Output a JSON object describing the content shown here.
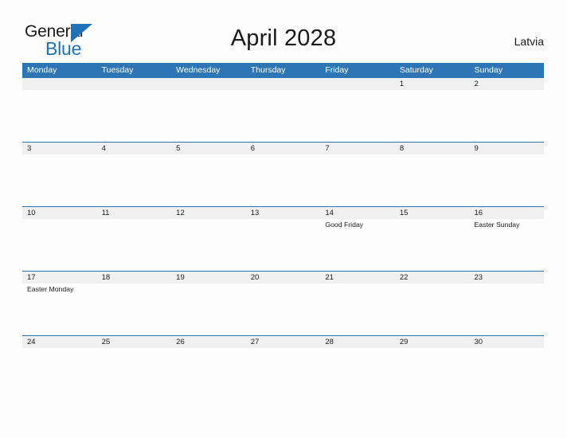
{
  "branding": {
    "name_part1": "General",
    "name_part2": "Blue",
    "triangle_icon": "triangle-icon",
    "colors": {
      "brand_blue": "#1f72b8",
      "header_blue": "#2e75b6",
      "date_band_gray": "#f0f0f0",
      "text_dark": "#1a1a1a",
      "page_background": "#fdfdfd"
    }
  },
  "header": {
    "title": "April 2028",
    "country": "Latvia"
  },
  "calendar": {
    "weekday_headers": [
      "Monday",
      "Tuesday",
      "Wednesday",
      "Thursday",
      "Friday",
      "Saturday",
      "Sunday"
    ],
    "weeks": [
      [
        {
          "day": "",
          "event": ""
        },
        {
          "day": "",
          "event": ""
        },
        {
          "day": "",
          "event": ""
        },
        {
          "day": "",
          "event": ""
        },
        {
          "day": "",
          "event": ""
        },
        {
          "day": "1",
          "event": ""
        },
        {
          "day": "2",
          "event": ""
        }
      ],
      [
        {
          "day": "3",
          "event": ""
        },
        {
          "day": "4",
          "event": ""
        },
        {
          "day": "5",
          "event": ""
        },
        {
          "day": "6",
          "event": ""
        },
        {
          "day": "7",
          "event": ""
        },
        {
          "day": "8",
          "event": ""
        },
        {
          "day": "9",
          "event": ""
        }
      ],
      [
        {
          "day": "10",
          "event": ""
        },
        {
          "day": "11",
          "event": ""
        },
        {
          "day": "12",
          "event": ""
        },
        {
          "day": "13",
          "event": ""
        },
        {
          "day": "14",
          "event": "Good Friday"
        },
        {
          "day": "15",
          "event": ""
        },
        {
          "day": "16",
          "event": "Easter Sunday"
        }
      ],
      [
        {
          "day": "17",
          "event": "Easter Monday"
        },
        {
          "day": "18",
          "event": ""
        },
        {
          "day": "19",
          "event": ""
        },
        {
          "day": "20",
          "event": ""
        },
        {
          "day": "21",
          "event": ""
        },
        {
          "day": "22",
          "event": ""
        },
        {
          "day": "23",
          "event": ""
        }
      ],
      [
        {
          "day": "24",
          "event": ""
        },
        {
          "day": "25",
          "event": ""
        },
        {
          "day": "26",
          "event": ""
        },
        {
          "day": "27",
          "event": ""
        },
        {
          "day": "28",
          "event": ""
        },
        {
          "day": "29",
          "event": ""
        },
        {
          "day": "30",
          "event": ""
        }
      ]
    ]
  }
}
